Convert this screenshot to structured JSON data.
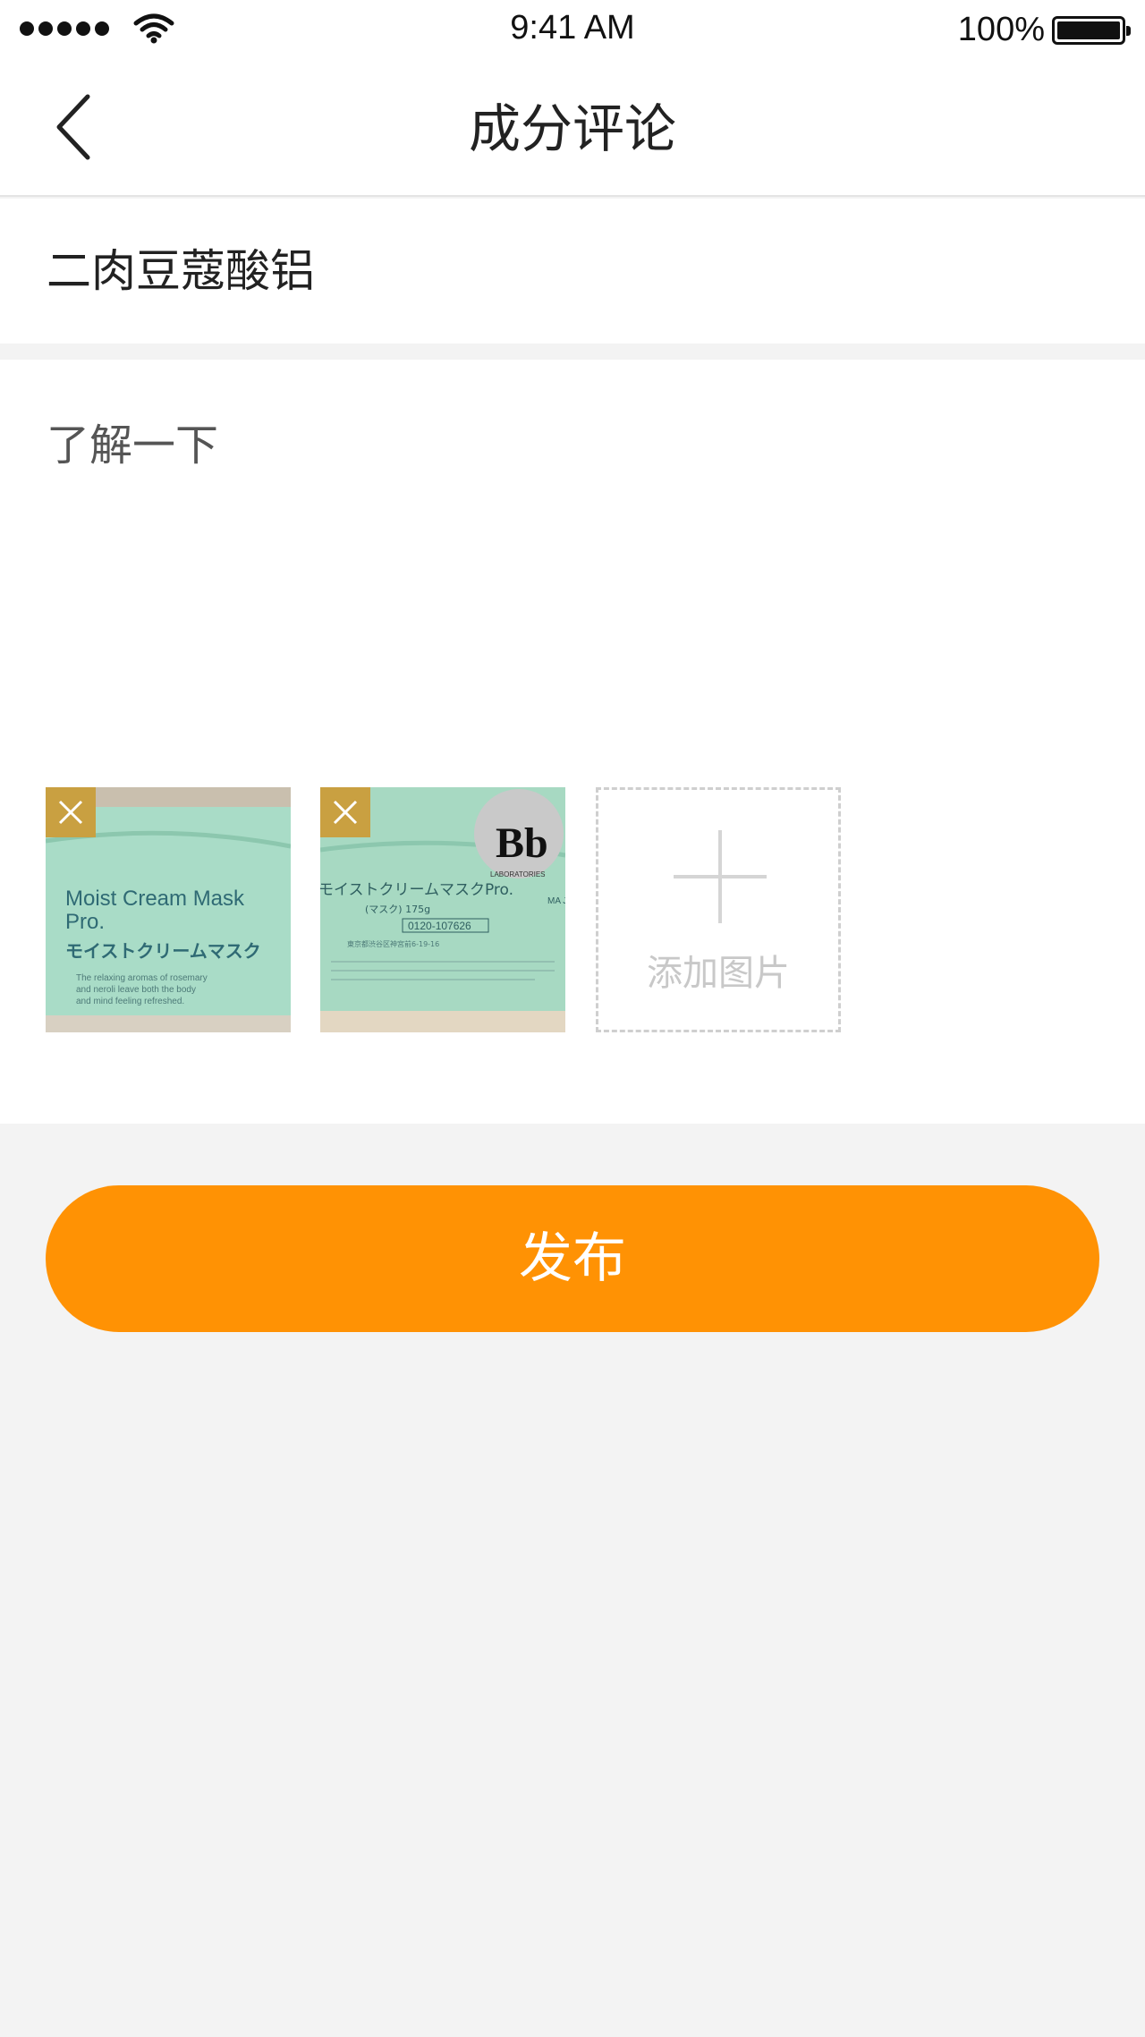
{
  "status_bar": {
    "time": "9:41 AM",
    "battery": "100%"
  },
  "nav": {
    "title": "成分评论"
  },
  "ingredient": {
    "name": "二肉豆蔻酸铝"
  },
  "comment": {
    "text": "了解一下"
  },
  "photos": [
    {
      "line1": "Moist Cream Mask",
      "line2": "Pro.",
      "line3": "モイストクリームマスク",
      "small1": "The relaxing aromas of rosemary",
      "small2": "and neroli leave both the body",
      "small3": "and mind feeling refreshed."
    },
    {
      "line1": "モイストクリームマスクPro.",
      "line2": "(マスク) 175g",
      "line3": "0120-107626",
      "line4": "東京都渋谷区神宮前6-19-16",
      "logo": "Bb",
      "logo_sub": "LABORATORIES",
      "side": "MA JAPA"
    }
  ],
  "add_photo": {
    "label": "添加图片"
  },
  "actions": {
    "publish_label": "发布"
  },
  "colors": {
    "accent": "#ff9204",
    "remove_badge": "#c9a041",
    "jar": "#a9dcc7"
  }
}
